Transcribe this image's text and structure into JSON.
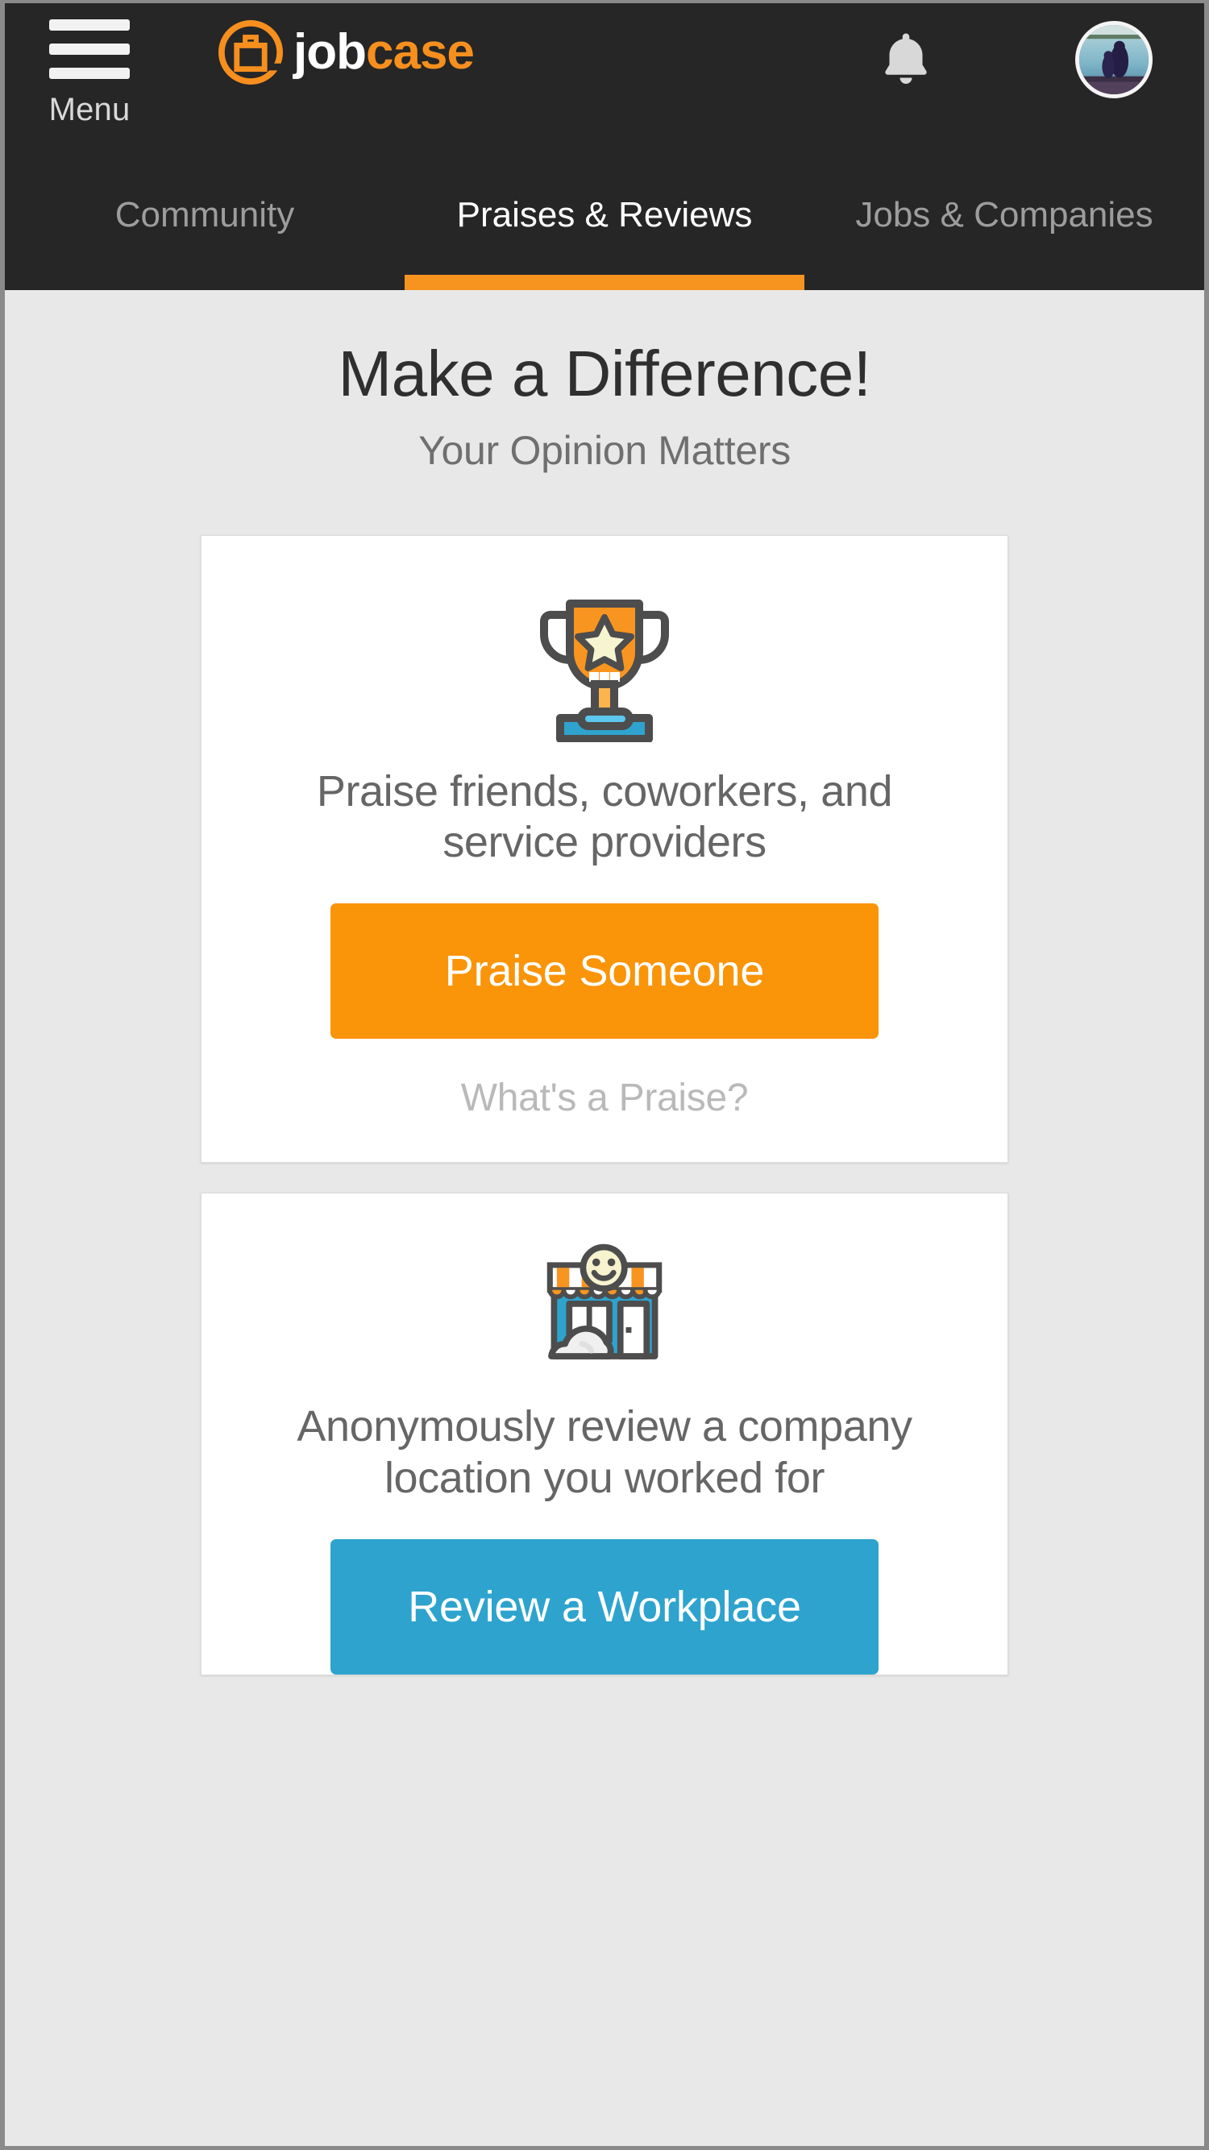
{
  "header": {
    "menu_label": "Menu",
    "brand_white": "job",
    "brand_orange": "case",
    "notifications_icon": "bell-icon",
    "avatar_icon": "user-avatar",
    "accent_color": "#f79420"
  },
  "tabs": [
    {
      "label": "Community",
      "active": false
    },
    {
      "label": "Praises & Reviews",
      "active": true
    },
    {
      "label": "Jobs & Companies",
      "active": false
    }
  ],
  "hero": {
    "title": "Make a Difference!",
    "subtitle": "Your Opinion Matters"
  },
  "cards": [
    {
      "id": "praise",
      "icon": "trophy-icon",
      "text": "Praise friends, coworkers, and service providers",
      "cta_label": "Praise Someone",
      "cta_color": "#fa9408",
      "helper_link": "What's a Praise?"
    },
    {
      "id": "review",
      "icon": "storefront-icon",
      "text": "Anonymously review a company location you worked for",
      "cta_label": "Review a Workplace",
      "cta_color": "#2ea3ce",
      "helper_link": null
    }
  ],
  "colors": {
    "page_background": "#e8e8e8",
    "header_background": "#262626",
    "card_background": "#ffffff",
    "orange": "#fa9408",
    "blue": "#2ea3ce",
    "text_gray": "#666666"
  }
}
